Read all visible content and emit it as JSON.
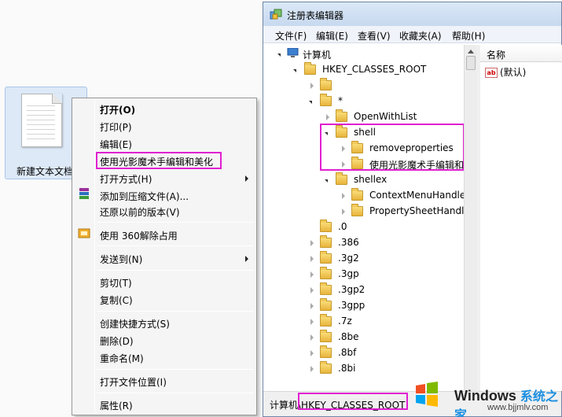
{
  "desktop": {
    "file_label": "新建文本文档"
  },
  "context_menu": {
    "items": [
      {
        "label": "打开(O)",
        "bold": true
      },
      {
        "label": "打印(P)"
      },
      {
        "label": "编辑(E)"
      },
      {
        "label": "使用光影魔术手编辑和美化"
      },
      {
        "label": "打开方式(H)",
        "submenu": true
      },
      {
        "label": "添加到压缩文件(A)..."
      },
      {
        "label": "还原以前的版本(V)"
      },
      {
        "label": "使用 360解除占用"
      },
      {
        "label": "发送到(N)",
        "submenu": true
      },
      {
        "label": "剪切(T)"
      },
      {
        "label": "复制(C)"
      },
      {
        "label": "创建快捷方式(S)"
      },
      {
        "label": "删除(D)"
      },
      {
        "label": "重命名(M)"
      },
      {
        "label": "打开文件位置(I)"
      },
      {
        "label": "属性(R)"
      }
    ]
  },
  "regedit": {
    "title": "注册表编辑器",
    "menu": [
      "文件(F)",
      "编辑(E)",
      "查看(V)",
      "收藏夹(A)",
      "帮助(H)"
    ],
    "tree": [
      {
        "label": "计算机",
        "icon": "computer-icon",
        "expanded": true
      },
      {
        "label": "HKEY_CLASSES_ROOT",
        "expanded": true
      },
      {
        "label": ""
      },
      {
        "label": "*",
        "expanded": true
      },
      {
        "label": "OpenWithList"
      },
      {
        "label": "shell",
        "expanded": true
      },
      {
        "label": "removeproperties"
      },
      {
        "label": "使用光影魔术手编辑和"
      },
      {
        "label": "shellex",
        "expanded": true
      },
      {
        "label": "ContextMenuHandler"
      },
      {
        "label": "PropertySheetHandle"
      },
      {
        "label": ".0"
      },
      {
        "label": ".386"
      },
      {
        "label": ".3g2"
      },
      {
        "label": ".3gp"
      },
      {
        "label": ".3gp2"
      },
      {
        "label": ".3gpp"
      },
      {
        "label": ".7z"
      },
      {
        "label": ".8be"
      },
      {
        "label": ".8bf"
      },
      {
        "label": ".8bi"
      }
    ],
    "column_header": "名称",
    "value_name": "(默认)",
    "status_prefix": "计算机",
    "status_path": "\\HKEY_CLASSES_ROOT"
  },
  "watermark": {
    "brand": "Windows",
    "brand_zh": "系统之家",
    "url": "www.bjjmlv.com"
  },
  "colors": {
    "highlight": "#e020d0",
    "folder": "#e8b43c"
  }
}
